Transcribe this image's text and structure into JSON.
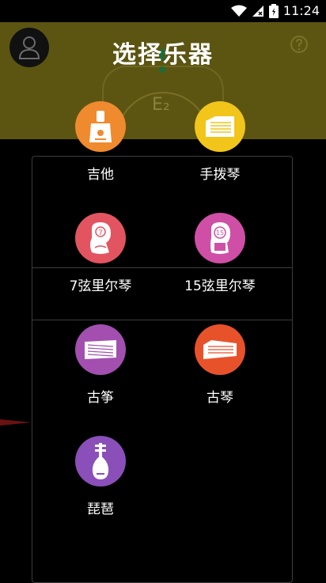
{
  "status_bar": {
    "time": "11:24"
  },
  "tuner": {
    "note": "E₂"
  },
  "modal": {
    "title": "选择乐器"
  },
  "instruments": [
    {
      "id": "guitar",
      "label": "吉他",
      "color": "#f08a2e"
    },
    {
      "id": "autoharp",
      "label": "手拨琴",
      "color": "#f2c51b"
    },
    {
      "id": "lyre7",
      "label": "7弦里尔琴",
      "color": "#e25560"
    },
    {
      "id": "lyre15",
      "label": "15弦里尔琴",
      "color": "#cf4fa6"
    },
    {
      "id": "guzheng",
      "label": "古筝",
      "color": "#a24fb0"
    },
    {
      "id": "guqin",
      "label": "古琴",
      "color": "#e8522b"
    },
    {
      "id": "pipa",
      "label": "琵琶",
      "color": "#8a4fb8"
    }
  ]
}
